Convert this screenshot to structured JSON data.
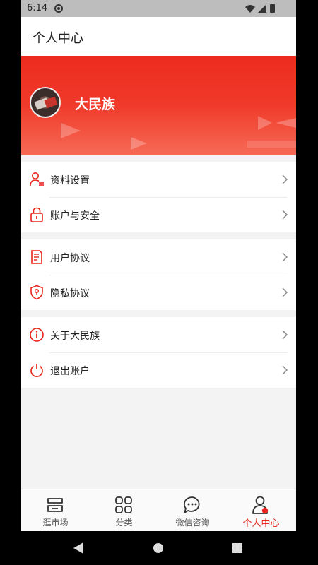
{
  "status_bar": {
    "time": "6:14"
  },
  "header": {
    "title": "个人中心"
  },
  "profile": {
    "name": "大民族"
  },
  "menu": {
    "group1": [
      {
        "label": "资料设置",
        "icon": "user-settings-icon"
      },
      {
        "label": "账户与安全",
        "icon": "lock-icon"
      }
    ],
    "group2": [
      {
        "label": "用户协议",
        "icon": "document-icon"
      },
      {
        "label": "隐私协议",
        "icon": "shield-icon"
      }
    ],
    "group3": [
      {
        "label": "关于大民族",
        "icon": "info-icon"
      },
      {
        "label": "退出账户",
        "icon": "power-icon"
      }
    ]
  },
  "tabs": [
    {
      "label": "逛市场",
      "icon": "shop-icon",
      "active": false
    },
    {
      "label": "分类",
      "icon": "grid-icon",
      "active": false
    },
    {
      "label": "微信咨询",
      "icon": "chat-icon",
      "active": false
    },
    {
      "label": "个人中心",
      "icon": "person-icon",
      "active": true
    }
  ],
  "colors": {
    "accent": "#e8261c",
    "banner_top": "#ec2b1e",
    "banner_bottom": "#f66a56"
  }
}
